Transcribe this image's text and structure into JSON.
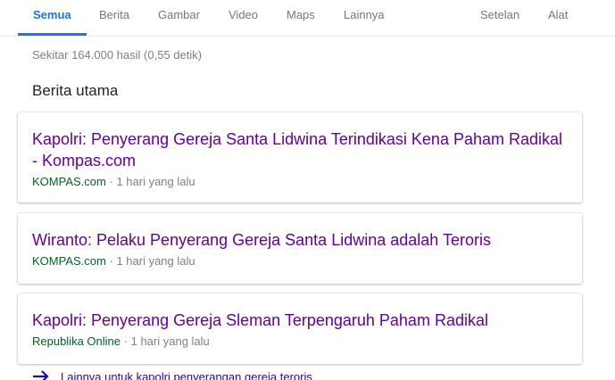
{
  "tabs": {
    "all": "Semua",
    "news": "Berita",
    "images": "Gambar",
    "video": "Video",
    "maps": "Maps",
    "more": "Lainnya",
    "settings": "Setelan",
    "tools": "Alat"
  },
  "result_stats": "Sekitar 164.000 hasil (0,55 detik)",
  "section_title": "Berita utama",
  "separator": "·",
  "stories": [
    {
      "headline": "Kapolri: Penyerang Gereja Santa Lidwina Terindikasi Kena Paham Radikal - Kompas.com",
      "source": "KOMPAS.com",
      "time": "1 hari yang lalu"
    },
    {
      "headline": "Wiranto: Pelaku Penyerang Gereja Santa Lidwina adalah Teroris",
      "source": "KOMPAS.com",
      "time": "1 hari yang lalu"
    },
    {
      "headline": "Kapolri: Penyerang Gereja Sleman Terpengaruh Paham Radikal",
      "source": "Republika Online",
      "time": "1 hari yang lalu"
    }
  ],
  "more_link": "Lainnya untuk kapolri penyerangan gereja teroris",
  "colors": {
    "active_tab": "#1a73e8",
    "visited_link": "#660099",
    "source": "#006621",
    "link": "#1a0dab"
  },
  "icons": {
    "more": "arrow-right-icon"
  }
}
